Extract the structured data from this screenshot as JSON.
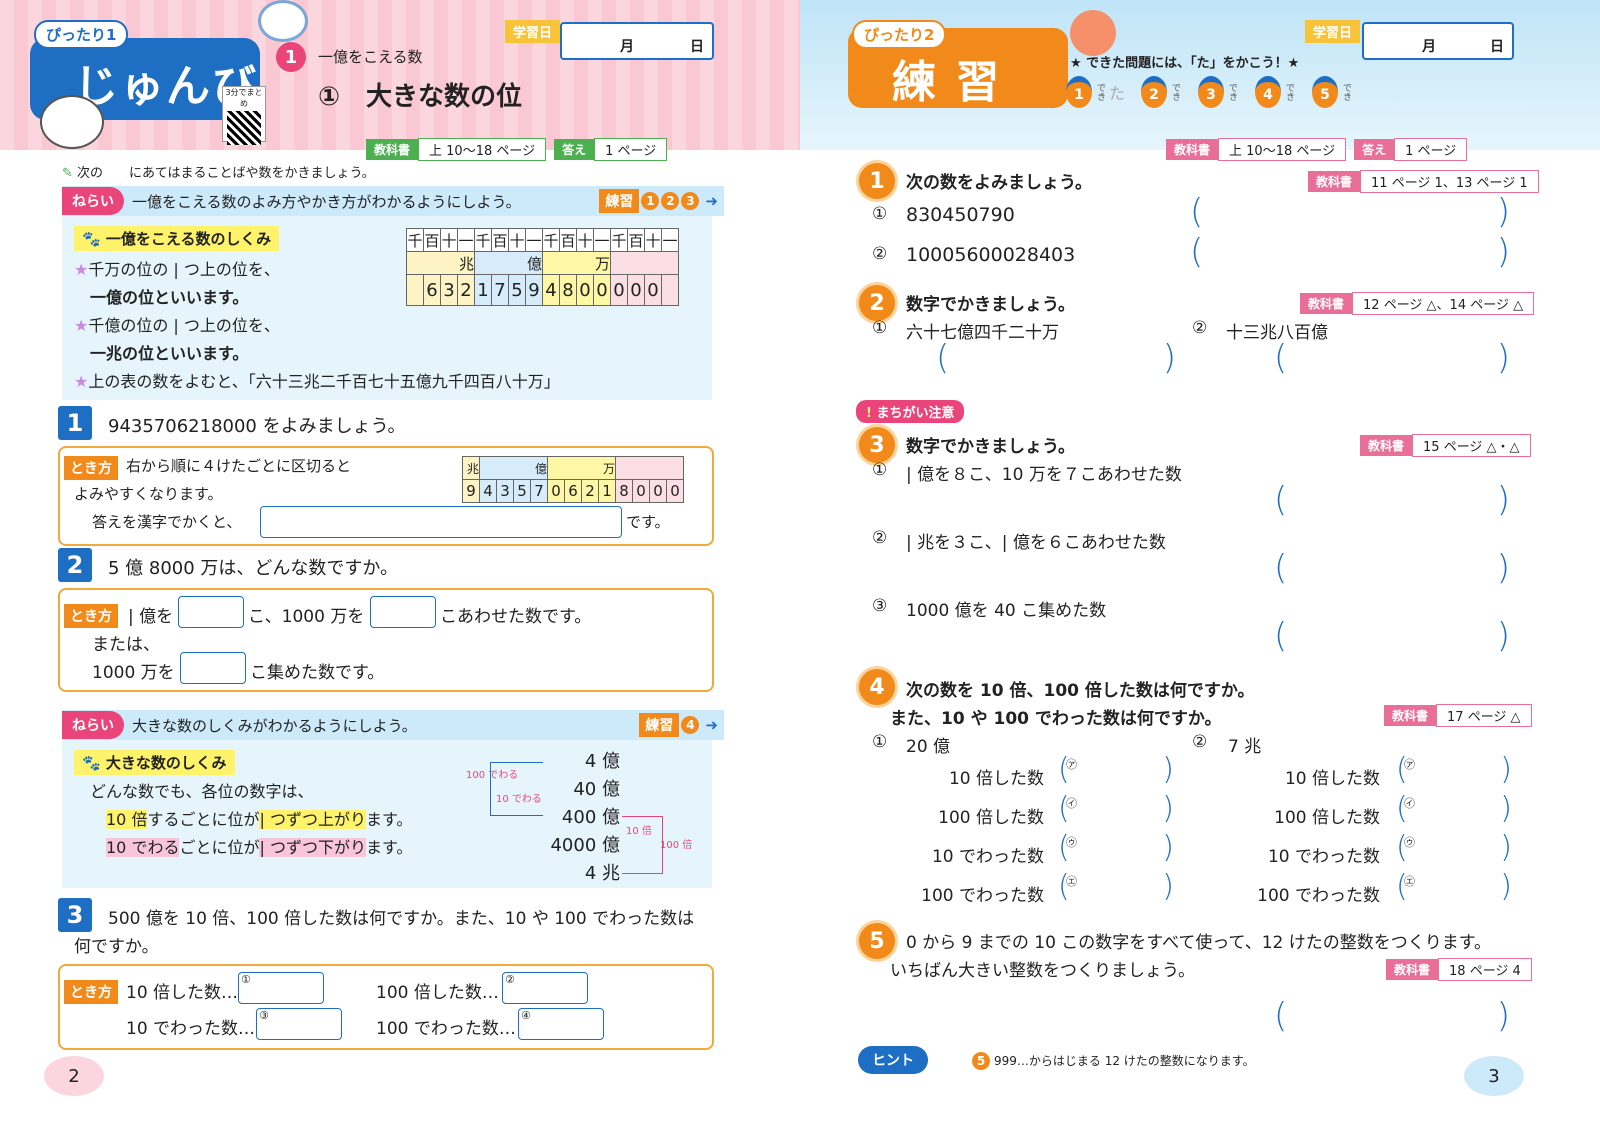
{
  "left": {
    "header": {
      "badge": "ぴったり1",
      "title": "じゅんび",
      "qr_label": "3分でまとめ",
      "unit_number": "1",
      "unit_name": "一億をこえる数",
      "lesson": "①　大きな数の位",
      "date_label": "学習日",
      "month": "月",
      "day": "日"
    },
    "refs": {
      "textbook_tag": "教科書",
      "textbook_val": "上 10〜18 ページ",
      "answer_tag": "答え",
      "answer_val": "1 ページ"
    },
    "instruction": "次の　　にあてはまることばや数をかきましょう。",
    "aim1": {
      "tag": "ねらい",
      "text": "一億をこえる数のよみ方やかき方がわかるようにしよう。",
      "practice": "練習",
      "nums": [
        "1",
        "2",
        "3"
      ]
    },
    "box1": {
      "tag": "一億をこえる数のしくみ",
      "lines": [
        "千万の位の | つ上の位を、",
        "一億の位といいます。",
        "千億の位の | つ上の位を、",
        "一兆の位といいます。",
        "上の表の数をよむと、「六十三兆二千百七十五億九千四百八十万」"
      ],
      "table_head": [
        "千",
        "百",
        "十",
        "一",
        "千",
        "百",
        "十",
        "一",
        "千",
        "百",
        "十",
        "一",
        "千",
        "百",
        "十",
        "一"
      ],
      "table_units": [
        "兆",
        "億",
        "万",
        ""
      ],
      "table_digits": [
        "",
        "6",
        "3",
        "2",
        "1",
        "7",
        "5",
        "9",
        "4",
        "8",
        "0",
        "0",
        "0",
        "0",
        "0",
        ""
      ]
    },
    "q1": {
      "num": "1",
      "text": "9435706218000 をよみましょう。",
      "hint_tag": "とき方",
      "hint1": "右から順に４けたごとに区切ると",
      "hint2": "よみやすくなります。",
      "hint3": "答えを漢字でかくと、",
      "hint_end": "です。",
      "units": [
        "兆",
        "億",
        "万"
      ],
      "digits": [
        "9",
        "4",
        "3",
        "5",
        "7",
        "0",
        "6",
        "2",
        "1",
        "8",
        "0",
        "0",
        "0"
      ]
    },
    "q2": {
      "num": "2",
      "text": "5 億 8000 万は、どんな数ですか。",
      "hint_tag": "とき方",
      "l1a": "| 億を",
      "l1b": "こ、1000 万を",
      "l1c": "こあわせた数です。",
      "l2": "または、",
      "l3a": "1000 万を",
      "l3b": "こ集めた数です。"
    },
    "aim2": {
      "tag": "ねらい",
      "text": "大きな数のしくみがわかるようにしよう。",
      "practice": "練習",
      "nums": [
        "4"
      ]
    },
    "box2": {
      "tag": "大きな数のしくみ",
      "l1": "どんな数でも、各位の数字は、",
      "l2a": "10 倍",
      "l2b": "するごとに位が",
      "l2c": "| つずつ上がり",
      "l2d": "ます。",
      "l3a": "10 でわる",
      "l3b": "ごとに位が",
      "l3c": "| つずつ下がり",
      "l3d": "ます。",
      "ladder": [
        "4 億",
        "40 億",
        "400 億",
        "4000 億",
        "4 兆"
      ],
      "arrow_labels": [
        "100 でわる",
        "10 でわる",
        "10 倍",
        "100 倍"
      ]
    },
    "q3": {
      "num": "3",
      "text1": "500 億を 10 倍、100 倍した数は何ですか。また、10 や 100 でわった数は",
      "text2": "何ですか。",
      "hint_tag": "とき方",
      "a1": "10 倍した数…",
      "a2": "100 倍した数…",
      "a3": "10 でわった数…",
      "a4": "100 でわった数…",
      "marks": [
        "①",
        "②",
        "③",
        "④"
      ]
    },
    "page_number": "2"
  },
  "right": {
    "header": {
      "badge": "ぴったり2",
      "title": "練 習",
      "goal": "★ できた問題には、「た」をかこう！★",
      "check_nums": [
        "1",
        "2",
        "3",
        "4",
        "5"
      ],
      "check_done": "た",
      "check_label": "でき",
      "date_label": "学習日",
      "month": "月",
      "day": "日"
    },
    "refs": {
      "textbook_tag": "教科書",
      "textbook_val": "上 10〜18 ページ",
      "answer_tag": "答え",
      "answer_val": "1 ページ"
    },
    "q1": {
      "num": "1",
      "text": "次の数をよみましょう。",
      "ref_tag": "教科書",
      "ref_val": "11 ページ 1、13 ページ 1",
      "items": [
        {
          "mark": "①",
          "value": "830450790"
        },
        {
          "mark": "②",
          "value": "10005600028403"
        }
      ]
    },
    "q2": {
      "num": "2",
      "text": "数字でかきましょう。",
      "ref_tag": "教科書",
      "ref_val": "12 ページ △、14 ページ △",
      "items": [
        {
          "mark": "①",
          "value": "六十七億四千二十万"
        },
        {
          "mark": "②",
          "value": "十三兆八百億"
        }
      ]
    },
    "warning": "まちがい注意",
    "q3": {
      "num": "3",
      "text": "数字でかきましょう。",
      "ref_tag": "教科書",
      "ref_val": "15 ページ △・△",
      "items": [
        {
          "mark": "①",
          "value": "| 億を８こ、10 万を７こあわせた数"
        },
        {
          "mark": "②",
          "value": "| 兆を３こ、| 億を６こあわせた数"
        },
        {
          "mark": "③",
          "value": "1000 億を 40 こ集めた数"
        }
      ]
    },
    "q4": {
      "num": "4",
      "text1": "次の数を 10 倍、100 倍した数は何ですか。",
      "text2": "また、10 や 100 でわった数は何ですか。",
      "ref_tag": "教科書",
      "ref_val": "17 ページ △",
      "left": {
        "mark": "①",
        "value": "20 億"
      },
      "right": {
        "mark": "②",
        "value": "7 兆"
      },
      "rows": [
        "10 倍した数",
        "100 倍した数",
        "10 でわった数",
        "100 でわった数"
      ],
      "row_marks": [
        "㋐",
        "㋑",
        "㋒",
        "㋓"
      ]
    },
    "q5": {
      "num": "5",
      "text1": "0 から 9 までの 10 この数字をすべて使って、12 けたの整数をつくります。",
      "text2": "いちばん大きい整数をつくりましょう。",
      "ref_tag": "教科書",
      "ref_val": "18 ページ 4"
    },
    "hint": {
      "label": "ヒント",
      "num": "5",
      "text": "999…からはじまる 12 けたの整数になります。"
    },
    "page_number": "3"
  },
  "colors": {
    "blue": "#1e6fc4",
    "orange": "#f28a1b",
    "pink": "#e96e98",
    "light_blue": "#cdeafa",
    "yellow": "#fff36b"
  }
}
